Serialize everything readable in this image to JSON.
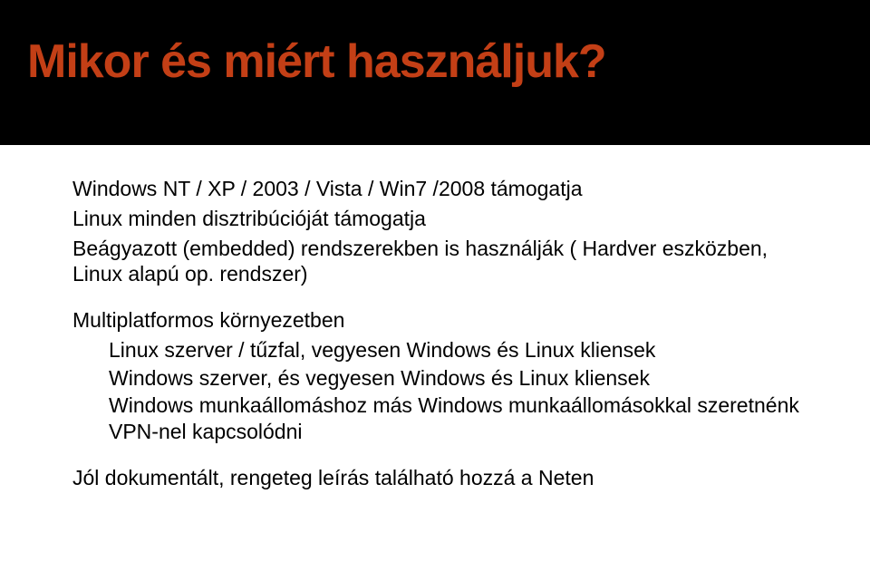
{
  "title": "Mikor és miért használjuk?",
  "bullets": [
    {
      "level": 1,
      "text": "Windows NT / XP / 2003 / Vista / Win7 /2008 támogatja"
    },
    {
      "level": 1,
      "text": "Linux minden disztribúcióját támogatja"
    },
    {
      "level": 1,
      "text": "Beágyazott (embedded) rendszerekben is használják ( Hardver eszközben, Linux alapú op. rendszer)"
    },
    {
      "level": 1,
      "text": "Multiplatformos környezetben",
      "spacedTop": true
    },
    {
      "level": 2,
      "text": "Linux szerver / tűzfal, vegyesen Windows és Linux kliensek"
    },
    {
      "level": 2,
      "text": "Windows szerver, és vegyesen Windows és Linux kliensek"
    },
    {
      "level": 2,
      "text": "Windows munkaállomáshoz más Windows munkaállomásokkal szeretnénk VPN-nel kapcsolódni"
    },
    {
      "level": 1,
      "text": "Jól dokumentált, rengeteg leírás található hozzá a Neten",
      "spacedTop": true
    }
  ]
}
